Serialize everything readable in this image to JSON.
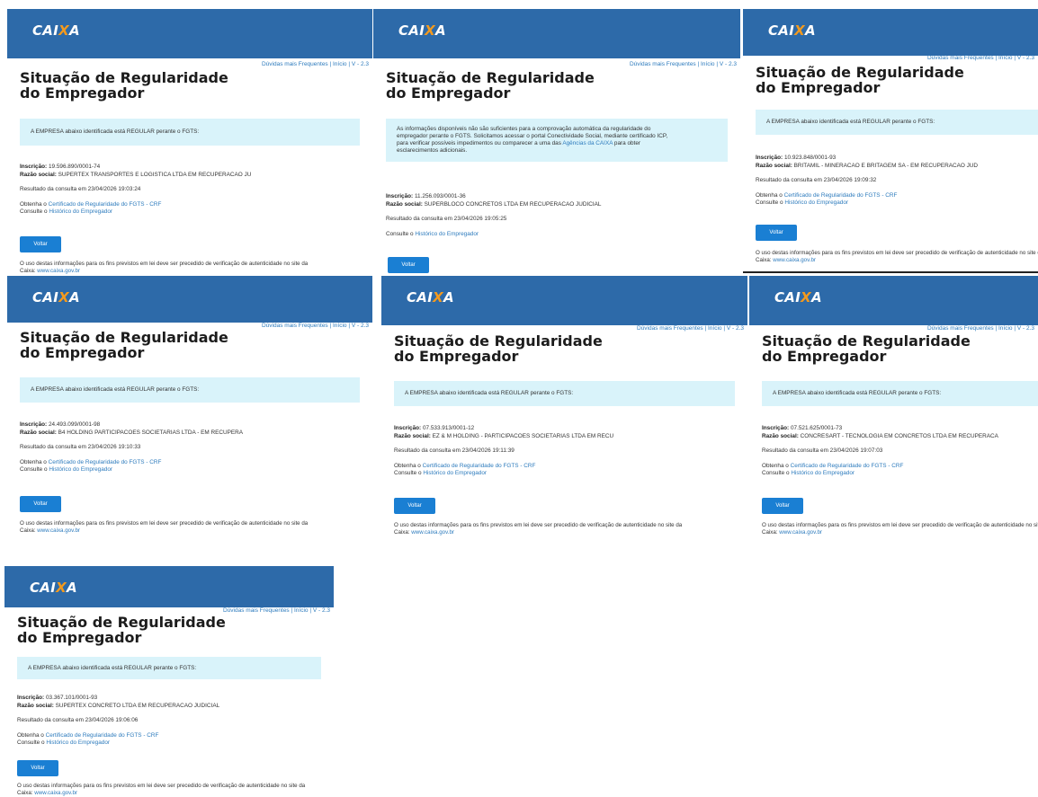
{
  "brand": {
    "pre": "CAI",
    "x": "X",
    "post": "A"
  },
  "top_links": {
    "duvidas": "Dúvidas mais Frequentes",
    "inicio": "Início",
    "version": "V - 2.3",
    "sep": "|"
  },
  "page_title": "Situação de Regularidade do Empregador",
  "labels": {
    "inscricao": "Inscrição:",
    "razao": "Razão social:",
    "resultado_prefix": "Resultado da consulta em",
    "obtenha_prefix": "Obtenha o",
    "crf_link": "Certificado de Regularidade do FGTS - CRF",
    "consulte_prefix": "Consulte o",
    "historico_link": "Histórico do Empregador",
    "button": "Voltar",
    "footer_text": "O uso destas informações para os fins previstos em lei deve ser precedido de verificação de autenticidade no site da",
    "footer_caixa": "Caixa:",
    "footer_url": "www.caixa.gov.br"
  },
  "msg_regular": "A EMPRESA abaixo identificada está REGULAR perante o FGTS:",
  "msg_irregular": {
    "line1": "As informações disponíveis não são suficientes para a comprovação automática da regularidade do",
    "line2": "empregador perante o FGTS. Solicitamos acessar o portal Conectividade Social, mediante certificado ICP,",
    "line3": "para verificar possíveis impedimentos ou comparecer a uma das",
    "link": "Agências da CAIXA",
    "line3b": "para obter",
    "line4": "esclarecimentos adicionais."
  },
  "panels": [
    {
      "inscricao": "19.596.890/0001-74",
      "razao": "SUPERTEX TRANSPORTES E LOGISTICA LTDA EM RECUPERACAO JU",
      "resultado": "23/04/2026 19:03:24"
    },
    {
      "inscricao": "11.256.093/0001-36",
      "razao": "SUPERBLOCO CONCRETOS LTDA EM RECUPERACAO JUDICIAL",
      "resultado": "23/04/2026 19:05:25"
    },
    {
      "inscricao": "10.923.848/0001-93",
      "razao": "BRITAMIL - MINERACAO E BRITAGEM SA - EM RECUPERACAO JUD",
      "resultado": "23/04/2026 19:09:32"
    },
    {
      "inscricao": "24.493.099/0001-98",
      "razao": "B4 HOLDING PARTICIPACOES SOCIETARIAS LTDA - EM RECUPERA",
      "resultado": "23/04/2026 19:10:33"
    },
    {
      "inscricao": "07.533.913/0001-12",
      "razao": "EZ & M HOLDING - PARTICIPACOES SOCIETARIAS LTDA EM RECU",
      "resultado": "23/04/2026 19:11:39"
    },
    {
      "inscricao": "07.521.625/0001-73",
      "razao": "CONCRESART - TECNOLOGIA EM CONCRETOS LTDA EM RECUPERACA",
      "resultado": "23/04/2026 19:07:03"
    },
    {
      "inscricao": "03.367.101/0001-93",
      "razao": "SUPERTEX CONCRETO LTDA EM RECUPERACAO JUDICIAL",
      "resultado": "23/04/2026 19:06:06"
    }
  ]
}
